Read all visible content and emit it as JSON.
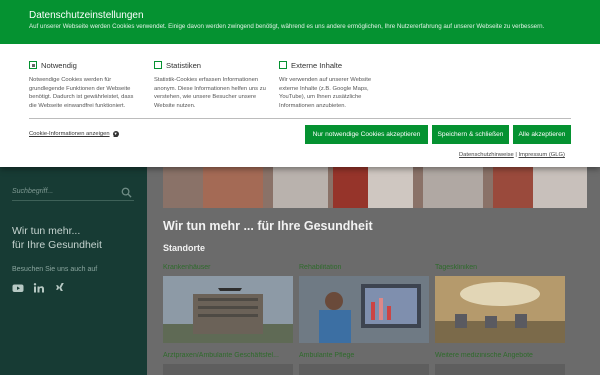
{
  "consent": {
    "title": "Datenschutzeinstellungen",
    "subtitle": "Auf unserer Webseite werden Cookies verwendet. Einige davon werden zwingend benötigt, während es uns andere ermöglichen, Ihre Nutzererfahrung auf unserer Webseite zu verbessern.",
    "options": [
      {
        "label": "Notwendig",
        "checked": true,
        "desc": "Notwendige Cookies werden für grundlegende Funktionen der Webseite benötigt. Dadurch ist gewährleistet, dass die Webseite einwandfrei funktioniert."
      },
      {
        "label": "Statistiken",
        "checked": false,
        "desc": "Statistik-Cookies erfassen Informationen anonym. Diese Informationen helfen uns zu verstehen, wie unsere Besucher unsere Website nutzen."
      },
      {
        "label": "Externe Inhalte",
        "checked": false,
        "desc": "Wir verwenden auf unserer Website externe Inhalte (z.B. Google Maps, YouTube), um Ihnen zusätzliche Informationen anzubieten."
      }
    ],
    "info_link": "Cookie-Informationen anzeigen",
    "buttons": {
      "necessary": "Nur notwendige Cookies akzeptieren",
      "save": "Speichern & schließen",
      "accept_all": "Alle akzeptieren"
    },
    "footer": {
      "privacy": "Datenschutzhinweise",
      "separator": "|",
      "imprint": "Impressum (GLG)"
    },
    "colors": {
      "brand": "#059231"
    }
  },
  "sidebar": {
    "search_placeholder": "Suchbegriff...",
    "tagline_1": "Wir tun mehr...",
    "tagline_2": "für Ihre Gesundheit",
    "follow": "Besuchen Sie uns auch auf",
    "social_icons": [
      "youtube-icon",
      "linkedin-icon",
      "xing-icon"
    ]
  },
  "main": {
    "heading": "Wir tun mehr ... für Ihre Gesundheit",
    "section": "Standorte",
    "cards": [
      {
        "title": "Krankenhäuser"
      },
      {
        "title": "Rehabilitation"
      },
      {
        "title": "Tageskliniken"
      },
      {
        "title": "Arztpraxen/Ambulante Geschäftsfel..."
      },
      {
        "title": "Ambulante Pflege"
      },
      {
        "title": "Weitere medizinische Angebote"
      }
    ]
  }
}
